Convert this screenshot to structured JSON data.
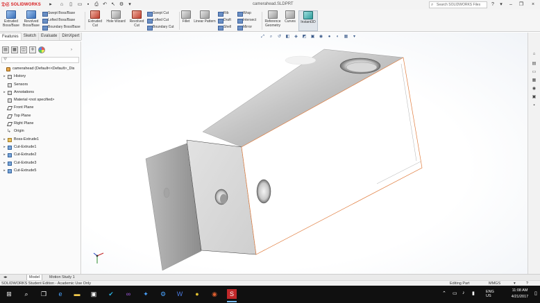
{
  "app": {
    "brand": "SOLIDWORKS",
    "doc_title": "camerahead.SLDPRT",
    "search_placeholder": "Search SOLIDWORKS Files"
  },
  "ribbon": {
    "extruded_boss": "Extruded\nBoss/Base",
    "revolved_boss": "Revolved\nBoss/Base",
    "swept_boss": "Swept Boss/Base",
    "lofted_boss": "Lofted Boss/Base",
    "boundary_boss": "Boundary Boss/Base",
    "extruded_cut": "Extruded\nCut",
    "hole_wizard": "Hole Wizard",
    "revolved_cut": "Revolved\nCut",
    "swept_cut": "Swept Cut",
    "lofted_cut": "Lofted Cut",
    "boundary_cut": "Boundary Cut",
    "fillet": "Fillet",
    "linear_pattern": "Linear Pattern",
    "rib": "Rib",
    "draft": "Draft",
    "shell": "Shell",
    "wrap": "Wrap",
    "intersect": "Intersect",
    "mirror": "Mirror",
    "reference_geometry": "Reference\nGeometry",
    "curves": "Curves",
    "instant3d": "Instant3D"
  },
  "cm_tabs": [
    "Features",
    "Sketch",
    "Evaluate",
    "DimXpert"
  ],
  "feature_tree": {
    "filter_icon": "funnel-icon",
    "items": [
      {
        "label": "camerahead (Default<<Default>_Dis",
        "icon": "part",
        "exp": "",
        "indent": 0
      },
      {
        "label": "History",
        "icon": "history",
        "exp": "▸",
        "indent": 1
      },
      {
        "label": "Sensors",
        "icon": "sensor",
        "exp": "",
        "indent": 1
      },
      {
        "label": "Annotations",
        "icon": "annotation",
        "exp": "▸",
        "indent": 1
      },
      {
        "label": "Material <not specified>",
        "icon": "material",
        "exp": "",
        "indent": 1
      },
      {
        "label": "Front Plane",
        "icon": "plane",
        "exp": "",
        "indent": 1
      },
      {
        "label": "Top Plane",
        "icon": "plane",
        "exp": "",
        "indent": 1
      },
      {
        "label": "Right Plane",
        "icon": "plane",
        "exp": "",
        "indent": 1
      },
      {
        "label": "Origin",
        "icon": "origin",
        "exp": "",
        "indent": 1
      },
      {
        "label": "Boss-Extrude1",
        "icon": "feat",
        "exp": "▸",
        "indent": 1
      },
      {
        "label": "Cut-Extrude1",
        "icon": "cut",
        "exp": "▸",
        "indent": 1
      },
      {
        "label": "Cut-Extrude2",
        "icon": "cut",
        "exp": "▸",
        "indent": 1
      },
      {
        "label": "Cut-Extrude3",
        "icon": "cut",
        "exp": "▸",
        "indent": 1
      },
      {
        "label": "Cut-Extrude5",
        "icon": "cut",
        "exp": "▸",
        "indent": 1
      }
    ]
  },
  "bottom_tabs": [
    "Model",
    "Motion Study 1"
  ],
  "status": {
    "left": "SOLIDWORKS Student Edition - Academic Use Only",
    "editing": "Editing Part",
    "units": "MMGS"
  },
  "taskbar": {
    "lang": "ENG\nUS",
    "time": "11:08 AM",
    "date": "4/21/2017"
  }
}
